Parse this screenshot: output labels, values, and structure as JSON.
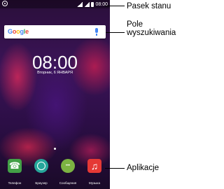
{
  "status_bar": {
    "time": "08:00"
  },
  "search": {
    "logo_text": "Google"
  },
  "lockscreen": {
    "time": "08:00",
    "date": "Вторник, 6 ЯНВАРЯ"
  },
  "dock": {
    "apps": [
      {
        "label": "Телефон",
        "icon": "phone-icon",
        "color": "#43a047"
      },
      {
        "label": "Браузер",
        "icon": "browser-icon",
        "color": "#26a69a"
      },
      {
        "label": "Сообщения",
        "icon": "messages-icon",
        "color": "#7cb342"
      },
      {
        "label": "Музыка",
        "icon": "music-icon",
        "color": "#e53935"
      }
    ]
  },
  "callouts": {
    "status_bar": "Pasek stanu",
    "search_line1": "Pole",
    "search_line2": "wyszukiwania",
    "apps": "Aplikacje"
  }
}
